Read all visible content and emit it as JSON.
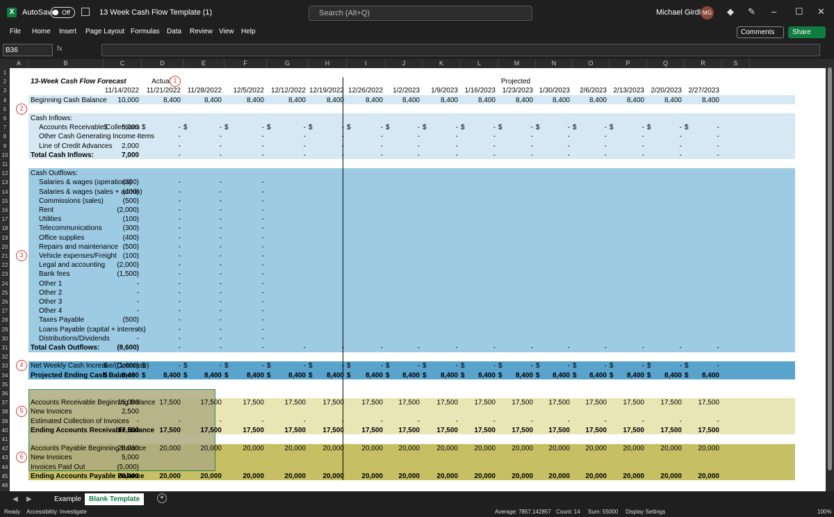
{
  "app": {
    "title": "13 Week Cash Flow Template (1)",
    "autosave": "AutoSave",
    "autosave_state": "Off",
    "search": "Search (Alt+Q)",
    "user": "Michael Girdley",
    "initials": "MG"
  },
  "menu": {
    "items": [
      "File",
      "Home",
      "Insert",
      "Page Layout",
      "Formulas",
      "Data",
      "Review",
      "View",
      "Help"
    ],
    "comments": "Comments",
    "share": "Share"
  },
  "formula": {
    "name_box": "B36",
    "fx": "fx"
  },
  "columns": [
    "A",
    "B",
    "C",
    "D",
    "E",
    "F",
    "G",
    "H",
    "I",
    "J",
    "K",
    "L",
    "M",
    "N",
    "O",
    "P",
    "Q",
    "R",
    "S"
  ],
  "rows": [
    "1",
    "2",
    "3",
    "4",
    "5",
    "6",
    "7",
    "8",
    "9",
    "10",
    "11",
    "12",
    "13",
    "14",
    "15",
    "16",
    "17",
    "18",
    "19",
    "20",
    "21",
    "22",
    "23",
    "24",
    "25",
    "26",
    "27",
    "28",
    "29",
    "30",
    "31",
    "32",
    "33",
    "34",
    "35",
    "36",
    "37",
    "38",
    "39",
    "40",
    "41",
    "42",
    "43",
    "44",
    "45",
    "46"
  ],
  "sheet": {
    "title": "13-Week  Cash Flow Forecast",
    "actual": "Actual",
    "projected": "Projected",
    "dates": [
      "11/14/2022",
      "11/21/2022",
      "11/28/2022",
      "12/5/2022",
      "12/12/2022",
      "12/19/2022",
      "12/26/2022",
      "1/2/2023",
      "1/9/2023",
      "1/16/2023",
      "1/23/2023",
      "1/30/2023",
      "2/6/2023",
      "2/13/2023",
      "2/20/2023",
      "2/27/2023"
    ],
    "beginning_label": "Beginning Cash Balance",
    "beginning_values": [
      "10,000",
      "8,400",
      "8,400",
      "8,400",
      "8,400",
      "8,400",
      "8,400",
      "8,400",
      "8,400",
      "8,400",
      "8,400",
      "8,400",
      "8,400",
      "8,400",
      "8,400",
      "8,400"
    ],
    "inflows_title": "Cash Inflows:",
    "inflow_items": [
      "Accounts Receivable Collections",
      "Other Cash Generating Income Items",
      "Line of Credit Advances"
    ],
    "ar_first": "5,000",
    "loc_first": "2,000",
    "total_inflows_label": "Total Cash Inflows:",
    "total_inflows_first": "7,000",
    "outflows_title": "Cash Outflows:",
    "outflow_items": [
      "Salaries & wages (operations)",
      "Salaries & wages (sales + admin)",
      "Commissions (sales)",
      "Rent",
      "Utilities",
      "Telecommunications",
      "Office supplies",
      "Repairs and maintenance",
      "Vehicle expenses/Freight",
      "Legal and accounting",
      "Bank fees",
      "Other 1",
      "Other 2",
      "Other 3",
      "Other 4",
      "Taxes Payable",
      "Loans Payable (capital + interests)",
      "Distributions/Dividends"
    ],
    "outflow_values": [
      "(300)",
      "(400)",
      "(500)",
      "(2,000)",
      "(100)",
      "(300)",
      "(400)",
      "(500)",
      "(100)",
      "(2,000)",
      "(1,500)",
      "-",
      "-",
      "-",
      "-",
      "(500)",
      "-",
      "-"
    ],
    "total_outflows_label": "Total Cash Outflows:",
    "total_outflows_first": "(8,600)",
    "net_label": "Net Weekly Cash Increase/(Decrease)",
    "net_first": "(1,600)",
    "ending_label": "Projected Ending Cash Balance",
    "ending_value": "8,400",
    "ar_labels": [
      "Accounts Receivable Beginning Balance",
      "New Invoices",
      "Estimated Collection of Invoices",
      "Ending Accounts Receivable Balance"
    ],
    "ar_first_vals": [
      "15,000",
      "2,500",
      "-",
      "17,500"
    ],
    "ar_value": "17,500",
    "ap_labels": [
      "Accounts Payable Beginning Balance",
      "New Invoices",
      "Invoices Paid Out",
      "Ending Accounts Payable Balance"
    ],
    "ap_first_vals": [
      "20,000",
      "5,000",
      "(5,000)",
      "20,000"
    ],
    "ap_value": "20,000",
    "dash": "-",
    "dollar": "$",
    "circles": [
      "1",
      "2",
      "3",
      "4",
      "5",
      "6"
    ]
  },
  "tabs": {
    "example": "Example",
    "blank": "Blank Template"
  },
  "status": {
    "ready": "Ready",
    "accessibility": "Accessibility: Investigate",
    "average": "Average: 7857.142857",
    "count": "Count: 14",
    "sum": "Sum: 55000",
    "display": "Display Settings",
    "zoom": "100%"
  },
  "colors": {
    "light_blue": "#d6e8f3",
    "mid_blue": "#9dcbe4",
    "dark_blue": "#5aa3cc",
    "light_olive": "#e9e6b6",
    "olive": "#c6bf64",
    "green": "#107c41"
  }
}
